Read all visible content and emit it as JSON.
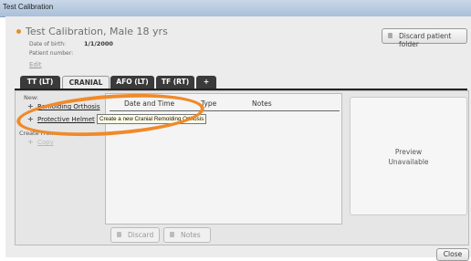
{
  "window": {
    "title": "Test Calibration"
  },
  "patient": {
    "name": "Test Calibration, Male 18 yrs",
    "dob_label": "Date of birth:",
    "dob_value": "1/1/2000",
    "patient_number_label": "Patient number:",
    "edit_label": "Edit",
    "discard_folder_label": "Discard patient folder"
  },
  "tabs": [
    "TT (LT)",
    "CRANIAL",
    "AFO (LT)",
    "TF (RT)",
    "+"
  ],
  "active_tab": "CRANIAL",
  "create_panel": {
    "create_label": "New:",
    "items": [
      "Remolding Orthosis",
      "Protective Helmet"
    ],
    "create_from_label": "Create From:",
    "copy_label": "Copy"
  },
  "list": {
    "headers": [
      "Date and Time",
      "Type",
      "Notes"
    ]
  },
  "preview": {
    "line1": "Preview",
    "line2": "Unavailable"
  },
  "buttons": {
    "discard": "Discard",
    "notes": "Notes",
    "close": "Close"
  },
  "tooltip": "Create a new Cranial Remolding Orthosis",
  "colors": {
    "annotation": "#f08a2a",
    "accent": "#e8901f",
    "tab_dark": "#3a3a3a"
  }
}
